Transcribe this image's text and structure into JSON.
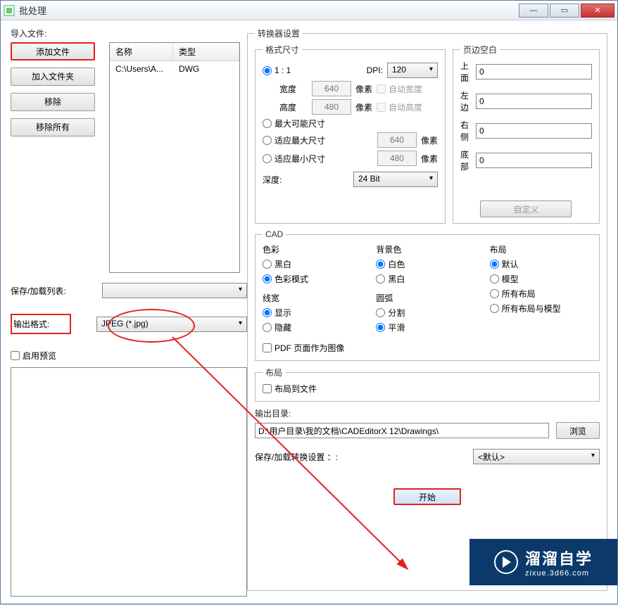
{
  "window": {
    "title": "批处理"
  },
  "left": {
    "import_label": "导入文件:",
    "btn_add_file": "添加文件",
    "btn_add_folder": "加入文件夹",
    "btn_remove": "移除",
    "btn_remove_all": "移除所有",
    "cols": {
      "name": "名称",
      "type": "类型"
    },
    "rows": [
      {
        "name": "C:\\Users\\A...",
        "type": "DWG"
      }
    ],
    "save_list_label": "保存/加载列表:",
    "output_format_label": "输出格式:",
    "output_format_value": "JPEG (*.jpg)",
    "enable_preview": "启用预览"
  },
  "conv": {
    "legend": "转换器设置",
    "fmt": {
      "legend": "格式尺寸",
      "one_to_one": "1 : 1",
      "dpi_label": "DPI:",
      "dpi_value": "120",
      "width_label": "宽度",
      "width_val": "640",
      "height_label": "高度",
      "height_val": "480",
      "pixel": "像素",
      "auto_width": "自动宽度",
      "auto_height": "自动高度",
      "max_possible": "最大可能尺寸",
      "fit_max": "适应最大尺寸",
      "fit_max_val": "640",
      "fit_min": "适应最小尺寸",
      "fit_min_val": "480",
      "depth_label": "深度:",
      "depth_value": "24 Bit"
    },
    "margins": {
      "legend": "页边空白",
      "top": "上面",
      "left": "左边",
      "right": "右侧",
      "bottom": "底部",
      "top_v": "0",
      "left_v": "0",
      "right_v": "0",
      "bottom_v": "0",
      "custom": "自定义"
    },
    "cad": {
      "legend": "CAD",
      "color_legend": "色彩",
      "bw": "黑白",
      "color_mode": "色彩模式",
      "bg_legend": "背景色",
      "white": "白色",
      "black": "黑白",
      "layout_legend": "布局",
      "def": "默认",
      "model": "模型",
      "all_layout": "所有布局",
      "all_model": "所有布局与模型",
      "lw_legend": "线宽",
      "show": "显示",
      "hide": "隐藏",
      "arc_legend": "圆弧",
      "split": "分割",
      "smooth": "平滑",
      "pdf_as_image": "PDF 页面作为图像"
    },
    "layout2": {
      "legend": "布局",
      "to_file": "布局到文件"
    },
    "outdir_label": "输出目录:",
    "outdir_value": "D:\\用户目录\\我的文档\\CADEditorX 12\\Drawings\\",
    "browse": "浏览",
    "save_settings_label": "保存/加载转换设置 ：:",
    "save_settings_value": "<默认>",
    "start": "开始"
  },
  "watermark": {
    "big": "溜溜自学",
    "small": "zixue.3d66.com"
  }
}
